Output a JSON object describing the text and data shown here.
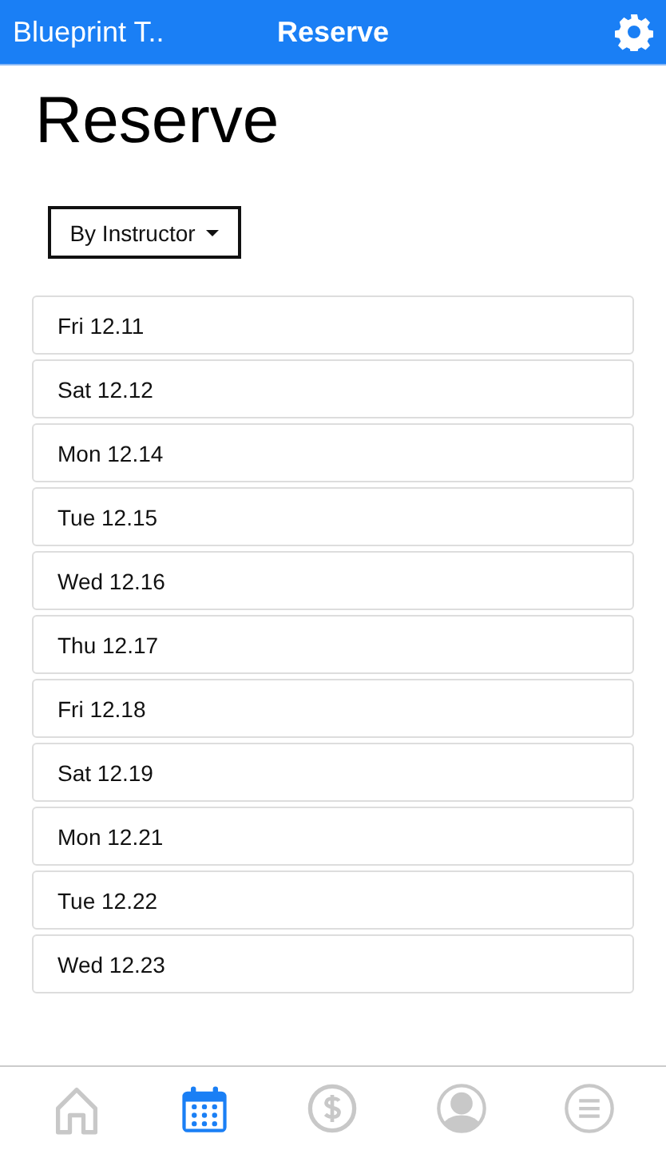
{
  "header": {
    "back_title": "Blueprint T..",
    "title": "Reserve"
  },
  "page_title": "Reserve",
  "filter": {
    "label": "By Instructor"
  },
  "dates": [
    {
      "label": "Fri 12.11"
    },
    {
      "label": "Sat 12.12"
    },
    {
      "label": "Mon 12.14"
    },
    {
      "label": "Tue 12.15"
    },
    {
      "label": "Wed 12.16"
    },
    {
      "label": "Thu 12.17"
    },
    {
      "label": "Fri 12.18"
    },
    {
      "label": "Sat 12.19"
    },
    {
      "label": "Mon 12.21"
    },
    {
      "label": "Tue 12.22"
    },
    {
      "label": "Wed 12.23"
    }
  ],
  "tab_bar": [
    {
      "kind": "home",
      "selected": false
    },
    {
      "kind": "calendar",
      "selected": true
    },
    {
      "kind": "payment",
      "selected": false
    },
    {
      "kind": "profile",
      "selected": false
    },
    {
      "kind": "menu",
      "selected": false
    }
  ]
}
